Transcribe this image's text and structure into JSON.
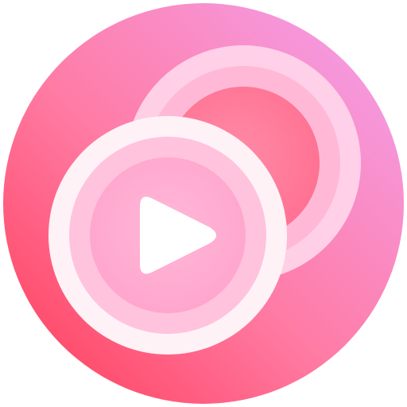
{
  "app": {
    "title": "",
    "icon_name": "media-player-icon"
  },
  "colors": {
    "bg_top_right": "#F2A2F0",
    "bg_bottom_left": "#FF3A55",
    "back_ring": "#FFD6EA",
    "back_inner": "#FF6E8F",
    "front_outer": "#FFF2F7",
    "front_mid": "#FFC3DE",
    "front_inner": "#FFA4CC",
    "play": "#FFFFFF"
  }
}
